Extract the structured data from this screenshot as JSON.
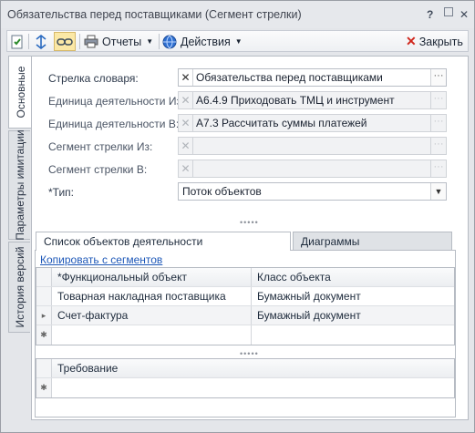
{
  "window": {
    "title": "Обязательства перед поставщиками (Сегмент стрелки)"
  },
  "titlebar": {
    "help": "?",
    "close": "✕"
  },
  "toolbar": {
    "reports_label": "Отчеты",
    "actions_label": "Действия",
    "close_label": "Закрыть"
  },
  "side_tabs": [
    "Основные",
    "Параметры имитации",
    "История версий"
  ],
  "form": {
    "arrow_label": "Стрелка словаря:",
    "arrow_value": "Обязательства перед поставщиками",
    "unit_from_label": "Единица деятельности Из:",
    "unit_from_value": "А6.4.9 Приходовать ТМЦ и инструмент",
    "unit_to_label": "Единица деятельности В:",
    "unit_to_value": "А7.3 Рассчитать суммы платежей",
    "seg_from_label": "Сегмент стрелки Из:",
    "seg_from_value": "",
    "seg_to_label": "Сегмент стрелки В:",
    "seg_to_value": "",
    "type_label": "*Тип:",
    "type_value": "Поток объектов"
  },
  "tabs": {
    "objects": "Список объектов деятельности",
    "diagrams": "Диаграммы"
  },
  "copy_link": "Копировать с сегментов",
  "objects_grid": {
    "columns": [
      "*Функциональный объект",
      "Класс объекта"
    ],
    "rows": [
      [
        "Товарная накладная поставщика",
        "Бумажный документ"
      ],
      [
        "Счет-фактура",
        "Бумажный документ"
      ]
    ]
  },
  "req_grid": {
    "columns": [
      "Требование"
    ]
  }
}
